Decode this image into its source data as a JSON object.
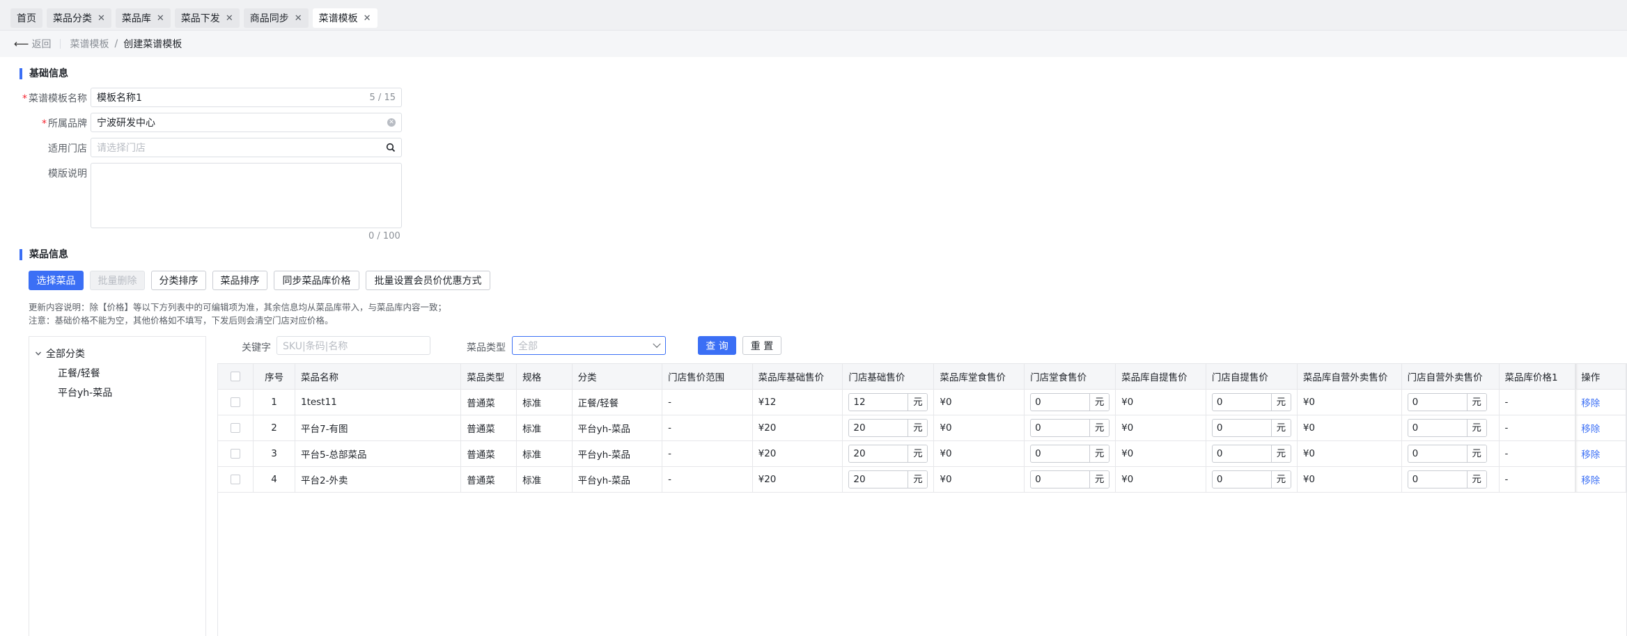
{
  "tabs": [
    {
      "label": "首页",
      "closable": false,
      "active": false
    },
    {
      "label": "菜品分类",
      "closable": true,
      "active": false
    },
    {
      "label": "菜品库",
      "closable": true,
      "active": false
    },
    {
      "label": "菜品下发",
      "closable": true,
      "active": false
    },
    {
      "label": "商品同步",
      "closable": true,
      "active": false
    },
    {
      "label": "菜谱模板",
      "closable": true,
      "active": true
    }
  ],
  "breadcrumb": {
    "back": "返回",
    "parent": "菜谱模板",
    "sep": "/",
    "current": "创建菜谱模板"
  },
  "basic": {
    "title": "基础信息",
    "name_label": "菜谱模板名称",
    "name_value": "模板名称1",
    "name_count": "5 / 15",
    "brand_label": "所属品牌",
    "brand_value": "宁波研发中心",
    "store_label": "适用门店",
    "store_placeholder": "请选择门店",
    "desc_label": "模版说明",
    "desc_count": "0 / 100"
  },
  "dishes": {
    "title": "菜品信息",
    "buttons": [
      "选择菜品",
      "批量删除",
      "分类排序",
      "菜品排序",
      "同步菜品库价格",
      "批量设置会员价优惠方式"
    ],
    "note1": "更新内容说明：除【价格】等以下方列表中的可编辑项为准，其余信息均从菜品库带入，与菜品库内容一致；",
    "note2": "注意：基础价格不能为空，其他价格如不填写，下发后则会清空门店对应价格。"
  },
  "tree": {
    "root": "全部分类",
    "children": [
      "正餐/轻餐",
      "平台yh-菜品"
    ]
  },
  "filter": {
    "keyword_label": "关键字",
    "keyword_placeholder": "SKU|条码|名称",
    "type_label": "菜品类型",
    "type_value": "全部",
    "query": "查 询",
    "reset": "重 置"
  },
  "table": {
    "headers": [
      "序号",
      "菜品名称",
      "菜品类型",
      "规格",
      "分类",
      "门店售价范围",
      "菜品库基础售价",
      "门店基础售价",
      "菜品库堂食售价",
      "门店堂食售价",
      "菜品库自提售价",
      "门店自提售价",
      "菜品库自营外卖售价",
      "门店自营外卖售价",
      "菜品库价格1",
      "操作"
    ],
    "unit": "元",
    "remove": "移除",
    "rows": [
      {
        "no": "1",
        "name": "1test11",
        "type": "普通菜",
        "spec": "标准",
        "cat": "正餐/轻餐",
        "range": "-",
        "lib_base": "¥12",
        "store_base": "12",
        "lib_dine": "¥0",
        "store_dine": "0",
        "lib_pick": "¥0",
        "store_pick": "0",
        "lib_deliv": "¥0",
        "store_deliv": "0",
        "lib_p1": "-"
      },
      {
        "no": "2",
        "name": "平台7-有图",
        "type": "普通菜",
        "spec": "标准",
        "cat": "平台yh-菜品",
        "range": "-",
        "lib_base": "¥20",
        "store_base": "20",
        "lib_dine": "¥0",
        "store_dine": "0",
        "lib_pick": "¥0",
        "store_pick": "0",
        "lib_deliv": "¥0",
        "store_deliv": "0",
        "lib_p1": "-"
      },
      {
        "no": "3",
        "name": "平台5-总部菜品",
        "type": "普通菜",
        "spec": "标准",
        "cat": "平台yh-菜品",
        "range": "-",
        "lib_base": "¥20",
        "store_base": "20",
        "lib_dine": "¥0",
        "store_dine": "0",
        "lib_pick": "¥0",
        "store_pick": "0",
        "lib_deliv": "¥0",
        "store_deliv": "0",
        "lib_p1": "-"
      },
      {
        "no": "4",
        "name": "平台2-外卖",
        "type": "普通菜",
        "spec": "标准",
        "cat": "平台yh-菜品",
        "range": "-",
        "lib_base": "¥20",
        "store_base": "20",
        "lib_dine": "¥0",
        "store_dine": "0",
        "lib_pick": "¥0",
        "store_pick": "0",
        "lib_deliv": "¥0",
        "store_deliv": "0",
        "lib_p1": "-"
      }
    ]
  }
}
